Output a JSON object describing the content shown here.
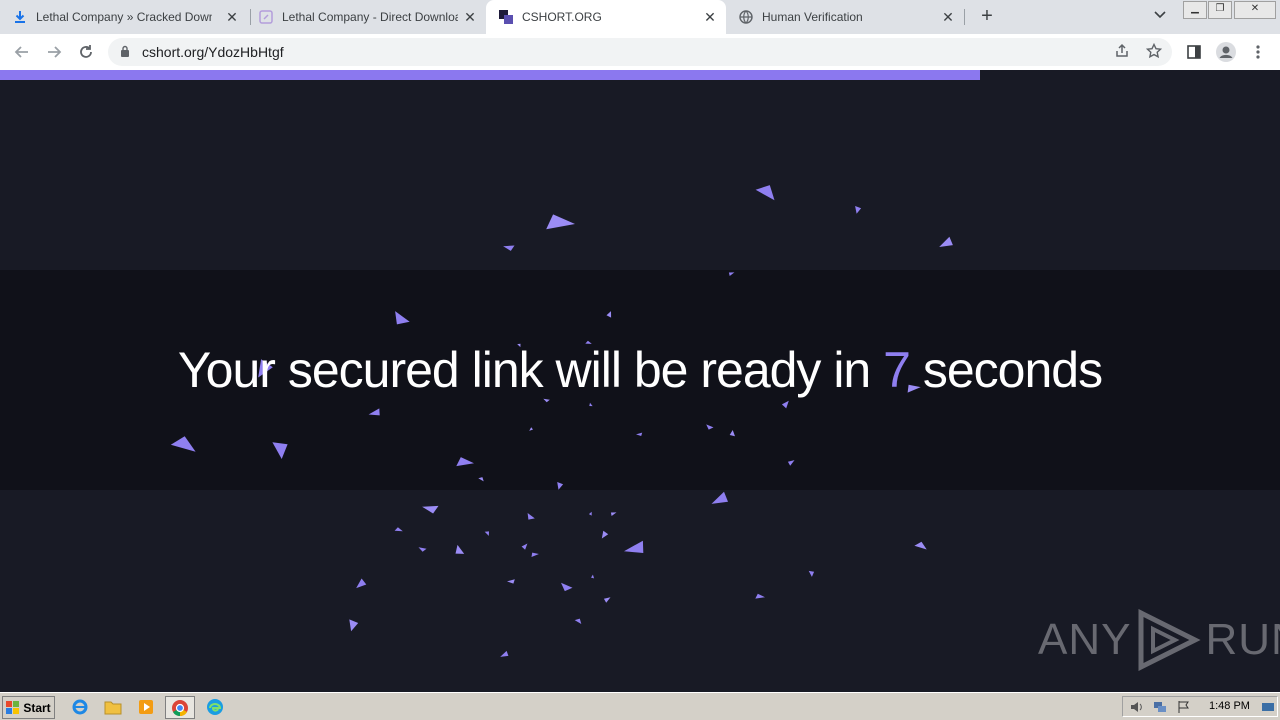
{
  "browser": {
    "tabs": [
      {
        "title": "Lethal Company » Cracked Download",
        "favicon": "download-icon",
        "active": false
      },
      {
        "title": "Lethal Company - Direct Download (F",
        "favicon": "page-icon",
        "active": false
      },
      {
        "title": "CSHORT.ORG",
        "favicon": "cshort-logo-icon",
        "active": true
      },
      {
        "title": "Human Verification",
        "favicon": "globe-icon",
        "active": false
      }
    ],
    "new_tab_symbol": "+",
    "url": "cshort.org/YdozHbHtgf",
    "load_progress_percent": 76.6
  },
  "page": {
    "headline_prefix": "Your secured link will be ready in ",
    "countdown": "7",
    "headline_suffix": " seconds",
    "accent_color": "#8f7ff0",
    "background_color": "#181a25",
    "watermark_left": "ANY",
    "watermark_right": "RUN"
  },
  "taskbar": {
    "start_label": "Start",
    "clock": "1:48 PM",
    "pinned": [
      "internet-explorer-icon",
      "file-explorer-icon",
      "media-player-icon",
      "chrome-icon",
      "edge-icon"
    ]
  }
}
